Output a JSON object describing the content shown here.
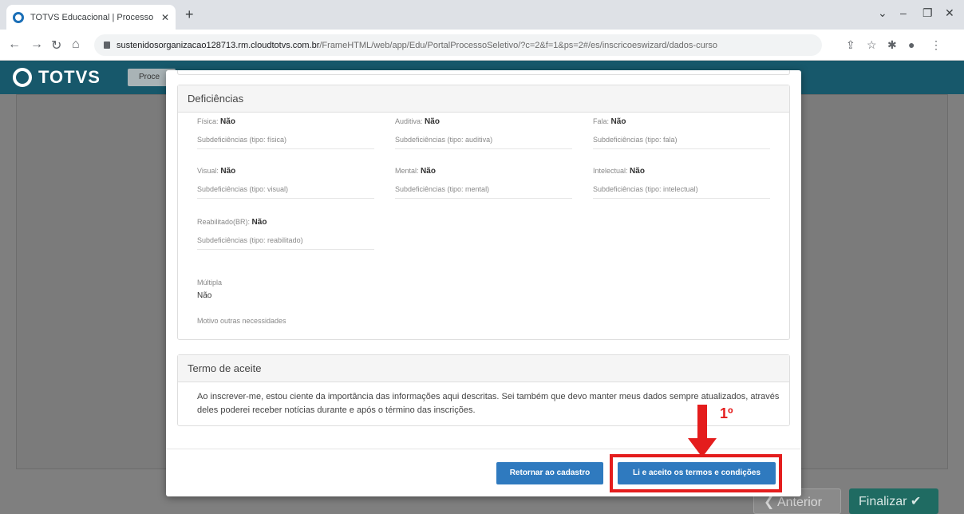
{
  "browser": {
    "tab_title": "TOTVS Educacional | Processo Se",
    "new_tab": "+",
    "url_host": "sustenidosorganizacao128713.rm.cloudtotvs.com.br",
    "url_path": "/FrameHTML/web/app/Edu/PortalProcessoSeletivo/?c=2&f=1&ps=2#/es/inscricoeswizard/dados-curso"
  },
  "app": {
    "logo": "TOTVS",
    "process_pill": "Proce"
  },
  "background": {
    "anterior": "Anterior",
    "finalizar": "Finalizar"
  },
  "deficiencias": {
    "title": "Deficiências",
    "fisica": {
      "label": "Física:",
      "value": "Não",
      "sub": "Subdeficiências (tipo: física)"
    },
    "auditiva": {
      "label": "Auditiva:",
      "value": "Não",
      "sub": "Subdeficiências (tipo: auditiva)"
    },
    "fala": {
      "label": "Fala:",
      "value": "Não",
      "sub": "Subdeficiências (tipo: fala)"
    },
    "visual": {
      "label": "Visual:",
      "value": "Não",
      "sub": "Subdeficiências (tipo: visual)"
    },
    "mental": {
      "label": "Mental:",
      "value": "Não",
      "sub": "Subdeficiências (tipo: mental)"
    },
    "intelectual": {
      "label": "Intelectual:",
      "value": "Não",
      "sub": "Subdeficiências (tipo: intelectual)"
    },
    "reabilitado": {
      "label": "Reabilitado(BR):",
      "value": "Não",
      "sub": "Subdeficiências (tipo: reabilitado)"
    },
    "multipla": {
      "label": "Múltipla",
      "value": "Não"
    },
    "motivo": "Motivo outras necessidades"
  },
  "termo": {
    "title": "Termo de aceite",
    "text": "Ao inscrever-me, estou ciente da importância das informações aqui descritas. Sei também que devo manter meus dados sempre atualizados, através deles poderei receber notícias durante e após o término das inscrições."
  },
  "actions": {
    "retornar": "Retornar ao cadastro",
    "aceito": "Li e aceito os termos e condições"
  },
  "annotation": {
    "step": "1º",
    "color": "#e41d1d"
  },
  "colors": {
    "header": "#17586b",
    "primary_button": "#2f7abf"
  }
}
